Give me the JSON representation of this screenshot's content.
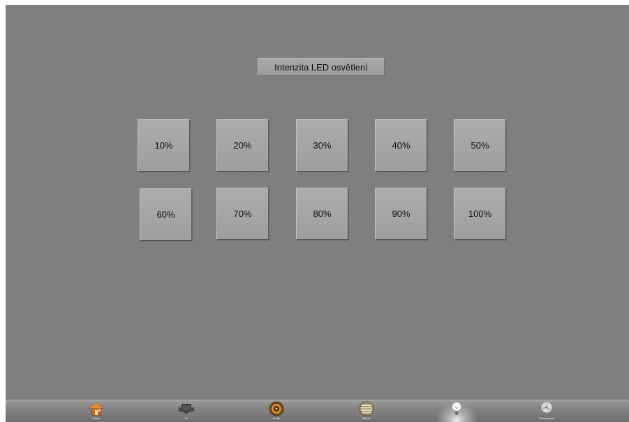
{
  "title": "Intenzita LED osvětlení",
  "levels": {
    "row1": [
      "10%",
      "20%",
      "30%",
      "40%",
      "50%"
    ],
    "row2": [
      "60%",
      "70%",
      "80%",
      "90%",
      "100%"
    ]
  },
  "dock": {
    "active": "lights",
    "items": [
      {
        "label": "Home",
        "icon": "house-icon"
      },
      {
        "label": "AV",
        "icon": "tv-icon"
      },
      {
        "label": "Audio",
        "icon": "speaker-icon"
      },
      {
        "label": "Blinds",
        "icon": "blinds-icon"
      },
      {
        "label": "Lights",
        "icon": "light-bulb-icon"
      },
      {
        "label": "Temperature",
        "icon": "fan-icon"
      }
    ]
  },
  "colors": {
    "background": "#7f7f7f",
    "button": "#a5a5a5",
    "dock": "#858585"
  }
}
